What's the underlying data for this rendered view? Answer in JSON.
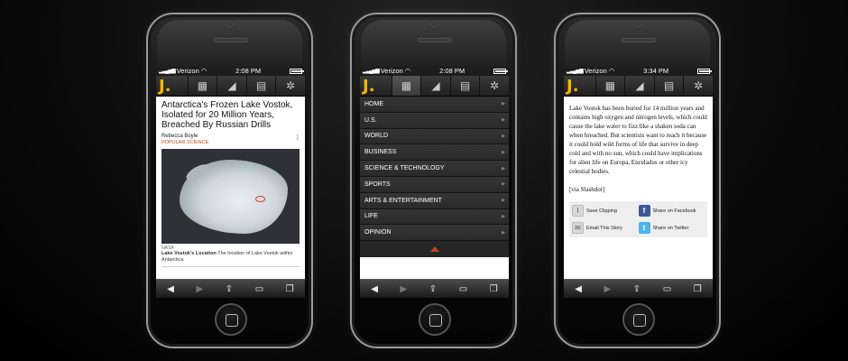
{
  "phones": [
    {
      "status": {
        "carrier": "Verizon",
        "time": "2:08 PM"
      },
      "article": {
        "headline": "Antarctica's Frozen Lake Vostok, Isolated for 20 Million Years, Breached By Russian Drills",
        "author": "Rebecca Boyle",
        "source": "POPULAR SCIENCE",
        "image_credit": "NASA",
        "caption_title": "Lake Vostok's Location",
        "caption_text": "The location of Lake Vostok within Antarctica"
      }
    },
    {
      "status": {
        "carrier": "Verizon",
        "time": "2:08 PM"
      },
      "menu": [
        "HOME",
        "U.S.",
        "WORLD",
        "BUSINESS",
        "SCIENCE & TECHNOLOGY",
        "SPORTS",
        "ARTS & ENTERTAINMENT",
        "LIFE",
        "OPINION"
      ]
    },
    {
      "status": {
        "carrier": "Verizon",
        "time": "3:34 PM"
      },
      "body": "Lake Vostok has been buried for 14 million years and contains high oxygen and nitrogen levels, which could cause the lake water to fizz like a shaken soda can when breached. But scientists want to reach it because it could hold wild forms of life that survive in deep cold and with no sun, which could have implications for alien life on Europa, Enceladus or other icy celestial bodies.",
      "via": "[via Slashdot]",
      "share": {
        "clipping": "Save Clipping",
        "facebook": "Share on Facebook",
        "email": "Email This Story",
        "twitter": "Share on Twitter"
      }
    }
  ],
  "app": {
    "logo": "J."
  },
  "icons": {
    "tabs": [
      "sections-icon",
      "cannon-icon",
      "library-icon",
      "settings-icon"
    ],
    "toolbar": [
      "back-icon",
      "forward-icon",
      "share-icon",
      "bookmarks-icon",
      "pages-icon"
    ]
  },
  "colors": {
    "logo": "#f2b705",
    "source": "#c04a1c",
    "facebook": "#3b5998",
    "twitter": "#4fb3e6"
  }
}
